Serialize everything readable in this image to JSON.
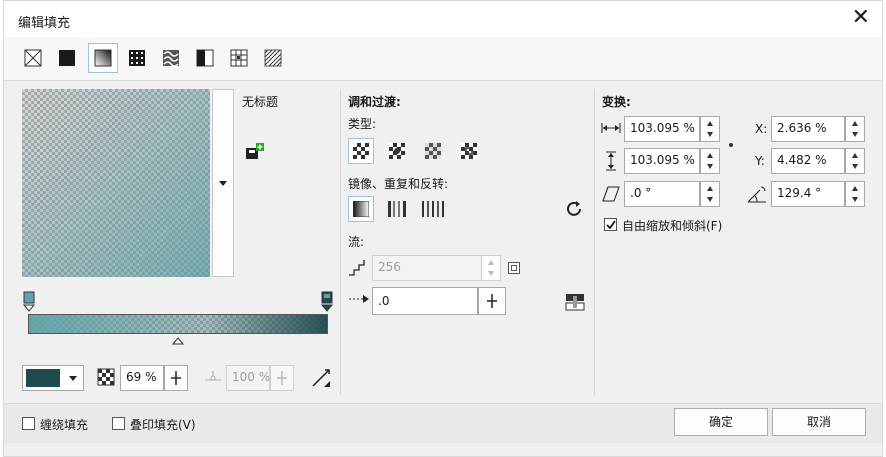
{
  "window": {
    "title": "编辑填充"
  },
  "toolbar": {
    "icons": [
      "no-fill-icon",
      "uniform-fill-icon",
      "fountain-fill-icon",
      "vector-pattern-icon",
      "bitmap-pattern-icon",
      "two-color-pattern-icon",
      "texture-fill-icon",
      "postscript-fill-icon"
    ]
  },
  "preview": {
    "name_label": "无标题"
  },
  "gradient": {
    "opacity_value": "69 %",
    "midpoint_value": "100 %",
    "color_hex": "#1f4a4e"
  },
  "blend": {
    "header": "调和过渡:",
    "type_label": "类型:",
    "mirror_label": "镜像、重复和反转:",
    "flow_label": "流:",
    "steps_value": "256",
    "accel_value": ".0"
  },
  "transform": {
    "header": "变换:",
    "width_value": "103.095 %",
    "height_value": "103.095 %",
    "skew_value": ".0 °",
    "x_label": "X:",
    "x_value": "2.636 %",
    "y_label": "Y:",
    "y_value": "4.482 %",
    "rotate_value": "129.4 °",
    "free_scale_label": "自由缩放和倾斜(F)"
  },
  "footer": {
    "wrap_fill_label": "缠绕填充",
    "overprint_label": "叠印填充(V)",
    "ok_label": "确定",
    "cancel_label": "取消"
  },
  "colors": {
    "accent": "#5fa3a8",
    "dark_teal": "#1f4a4e"
  }
}
